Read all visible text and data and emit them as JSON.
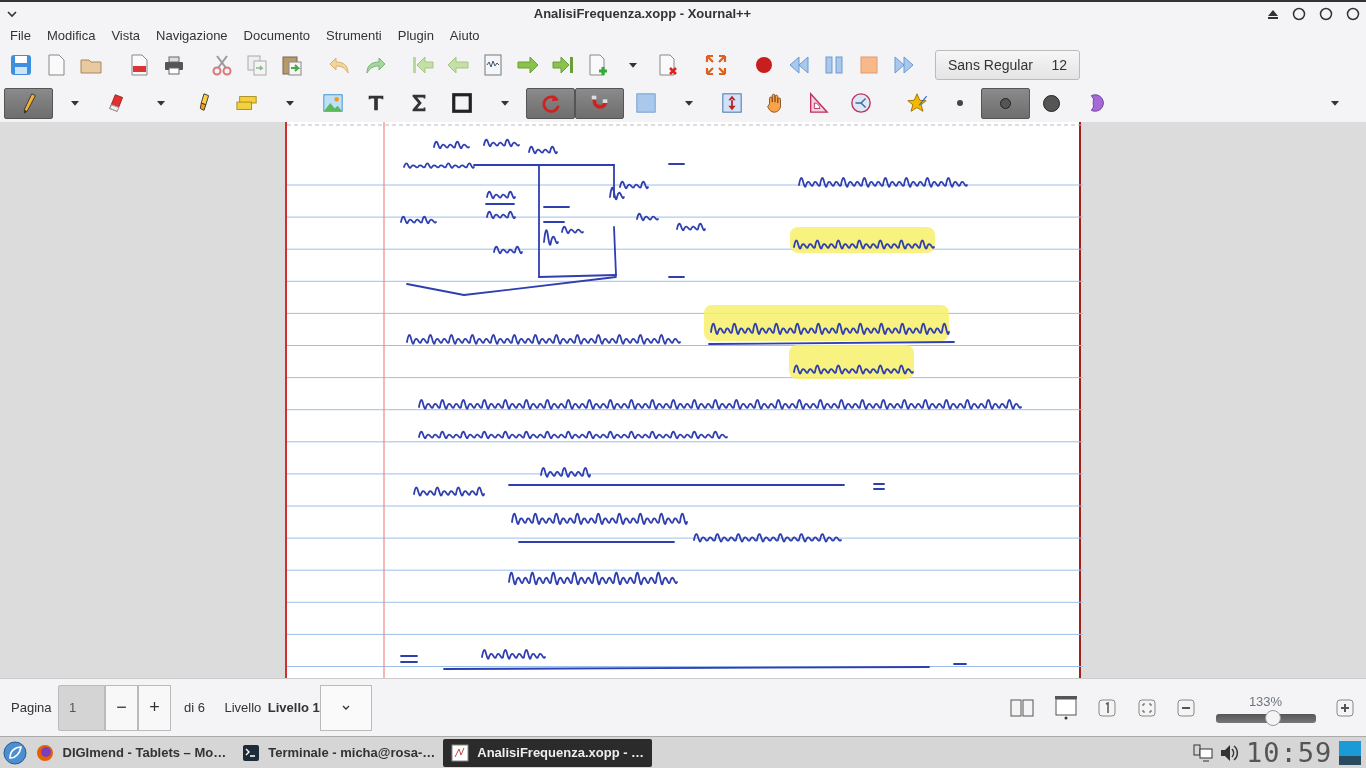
{
  "window": {
    "title": "AnalisiFrequenza.xopp - Xournal++"
  },
  "menu": [
    "File",
    "Modifica",
    "Vista",
    "Navigazione",
    "Documento",
    "Strumenti",
    "Plugin",
    "Aiuto"
  ],
  "main_toolbar": {
    "groups": [
      [
        {
          "kind": "save"
        },
        {
          "kind": "new"
        },
        {
          "kind": "open"
        }
      ],
      [
        {
          "kind": "pdf"
        },
        {
          "kind": "print"
        }
      ],
      [
        {
          "kind": "cut"
        },
        {
          "kind": "copy"
        },
        {
          "kind": "paste"
        }
      ],
      [
        {
          "kind": "undo"
        },
        {
          "kind": "redo"
        }
      ],
      [
        {
          "kind": "first"
        },
        {
          "kind": "prev"
        },
        {
          "kind": "goto"
        },
        {
          "kind": "next"
        },
        {
          "kind": "last"
        },
        {
          "kind": "addpage"
        },
        {
          "kind": "dropdown"
        },
        {
          "kind": "delpage"
        }
      ],
      [
        {
          "kind": "fullscreen"
        }
      ],
      [
        {
          "kind": "record"
        },
        {
          "kind": "rewind"
        },
        {
          "kind": "pause"
        },
        {
          "kind": "stop"
        },
        {
          "kind": "forward"
        }
      ]
    ],
    "font_button": {
      "font": "Sans Regular",
      "size": "12"
    }
  },
  "tools_toolbar": [
    {
      "kind": "pen",
      "selected": true
    },
    {
      "kind": "dropdown"
    },
    {
      "kind": "eraser",
      "selected": false
    },
    {
      "kind": "dropdown"
    },
    {
      "kind": "highlighter",
      "selected": false
    },
    {
      "kind": "textbox",
      "selected": false
    },
    {
      "kind": "dropdown"
    },
    {
      "kind": "image",
      "selected": false
    },
    {
      "kind": "text",
      "selected": false
    },
    {
      "kind": "sigma",
      "selected": false
    },
    {
      "kind": "rect",
      "selected": false
    },
    {
      "kind": "dropdown"
    },
    {
      "kind": "rotsnap",
      "selected": true
    },
    {
      "kind": "gridsnap",
      "selected": true
    },
    {
      "kind": "select",
      "selected": false
    },
    {
      "kind": "dropdown"
    },
    {
      "kind": "vspace",
      "selected": false
    },
    {
      "kind": "hand",
      "selected": false
    },
    {
      "kind": "setsquare",
      "selected": false
    },
    {
      "kind": "compass",
      "selected": false
    },
    {
      "kind": "star",
      "selected": false
    },
    {
      "kind": "thin",
      "selected": false
    },
    {
      "kind": "medium",
      "selected": true
    },
    {
      "kind": "thick",
      "selected": false
    },
    {
      "kind": "fill",
      "selected": false
    },
    {
      "kind": "enddrop"
    }
  ],
  "page_bar": {
    "label": "Pagina",
    "page": "1",
    "minus": "−",
    "plus": "+",
    "of": "di 6",
    "layer_label": "Livello",
    "layer": "Livello 1"
  },
  "zoom": {
    "percent": "133%",
    "level": 0.57
  },
  "taskbar": {
    "tasks": [
      {
        "kind": "browser",
        "label": "DIGImend - Tablets – Mo…",
        "selected": false
      },
      {
        "kind": "terminal",
        "label": "Terminale - micha@rosa-…",
        "selected": false
      },
      {
        "kind": "editor",
        "label": "AnalisiFrequenza.xopp - …",
        "selected": true
      }
    ],
    "clock": "10:59"
  }
}
